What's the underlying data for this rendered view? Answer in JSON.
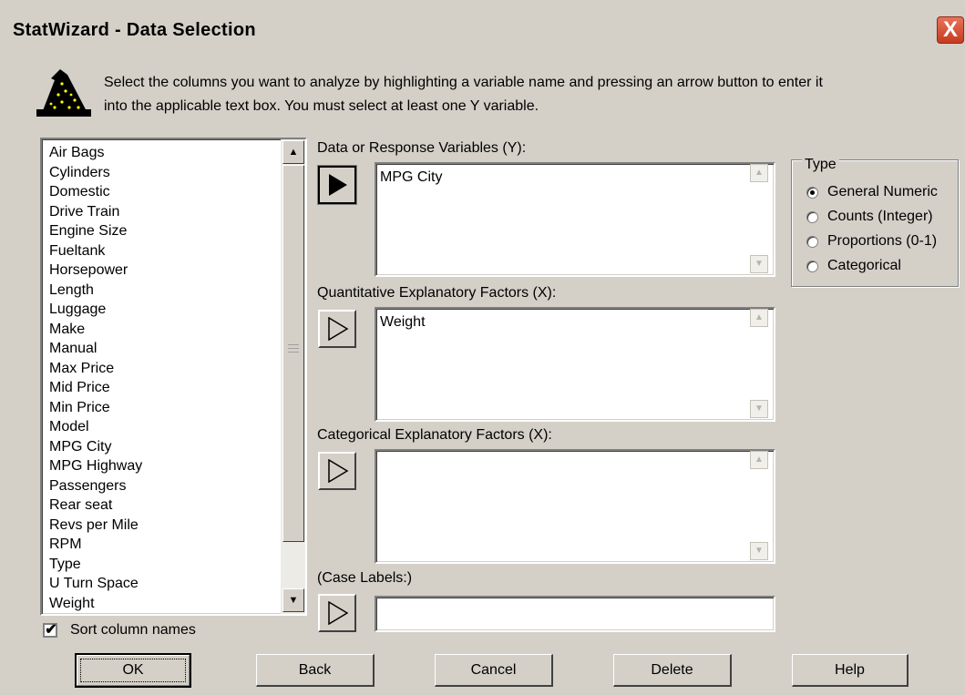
{
  "window": {
    "title": "StatWizard - Data Selection",
    "close_glyph": "X"
  },
  "instructions": "Select the columns you want to analyze by highlighting a variable name and pressing an arrow button to enter it into the applicable text box. You must select at least one Y variable.",
  "icon": {
    "name": "wizard-hat-icon",
    "color": "#000000",
    "star_color": "#ffff00"
  },
  "variables": [
    "Air Bags",
    "Cylinders",
    "Domestic",
    "Drive Train",
    "Engine Size",
    "Fueltank",
    "Horsepower",
    "Length",
    "Luggage",
    "Make",
    "Manual",
    "Max Price",
    "Mid Price",
    "Min Price",
    "Model",
    "MPG City",
    "MPG Highway",
    "Passengers",
    "Rear seat",
    "Revs per Mile",
    "RPM",
    "Type",
    "U Turn Space",
    "Weight"
  ],
  "fields": {
    "response": {
      "label": "Data or Response Variables (Y):",
      "value": "MPG City"
    },
    "quant": {
      "label": "Quantitative Explanatory Factors (X):",
      "value": "Weight"
    },
    "categ": {
      "label": "Categorical Explanatory Factors (X):",
      "value": ""
    },
    "case": {
      "label": "(Case Labels:)",
      "value": ""
    }
  },
  "type_group": {
    "legend": "Type",
    "options": [
      "General Numeric",
      "Counts (Integer)",
      "Proportions (0-1)",
      "Categorical"
    ],
    "selected": "General Numeric"
  },
  "sort": {
    "label": "Sort  column names",
    "checked": true,
    "check_glyph": "✔"
  },
  "buttons": {
    "ok": "OK",
    "back": "Back",
    "cancel": "Cancel",
    "delete": "Delete",
    "help": "Help"
  },
  "scroll": {
    "up": "▲",
    "down": "▼"
  }
}
